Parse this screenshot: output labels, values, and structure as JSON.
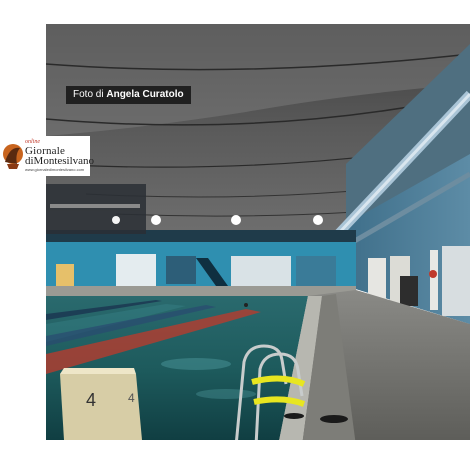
{
  "photo": {
    "credit_prefix": "Foto di",
    "credit_author": "Angela Curatolo",
    "block_number": "4",
    "block_number_side": "4"
  },
  "logo": {
    "online": "online",
    "title_line1": "Giornale",
    "title_line2": "diMontesilvano",
    "url": "www.giornaledimontesilvano.com"
  }
}
